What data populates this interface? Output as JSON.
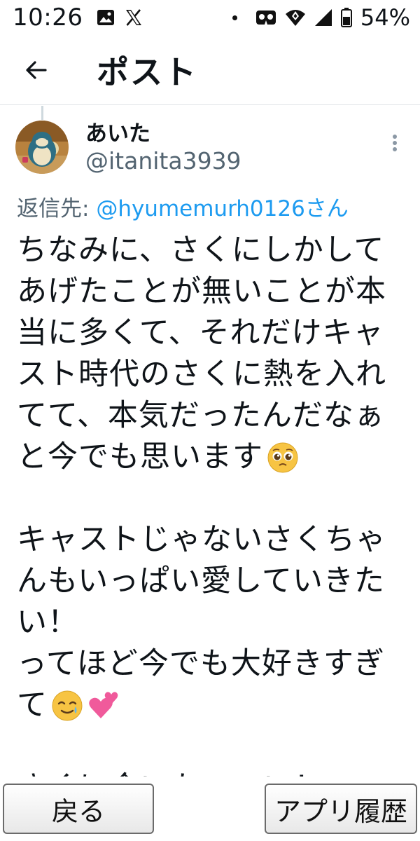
{
  "status_bar": {
    "time": "10:26",
    "battery_percent": "54%",
    "icons": [
      "image-icon",
      "x-logo-icon",
      "dot-icon",
      "vr-icon",
      "wifi-icon",
      "signal-icon",
      "battery-icon"
    ]
  },
  "header": {
    "title": "ポスト",
    "back_icon": "arrow-left-icon"
  },
  "post": {
    "author_name": "あいた",
    "author_handle": "@itanita3939",
    "reply_prefix": "返信先: ",
    "reply_to": "@hyumemurh0126さん",
    "lines": [
      "ちなみに、さくにしかして",
      "あげたことが無いことが本",
      "当に多くて、それだけキャ",
      "スト時代のさくに熱を入れ",
      "てて、本気だったんだなぁ",
      "と今でも思います",
      "",
      "キャストじゃないさくちゃ",
      "んもいっぱい愛していきた",
      "い！",
      "ってほど今でも大好きすぎ",
      "て",
      "",
      "さくに会いたーーい！"
    ],
    "emojis": {
      "line6": "pleading-face-emoji",
      "line12": [
        "smiling-face-with-tear-emoji",
        "two-hearts-emoji"
      ]
    }
  },
  "bottom_bar": {
    "back_label": "戻る",
    "history_label": "アプリ履歴"
  }
}
